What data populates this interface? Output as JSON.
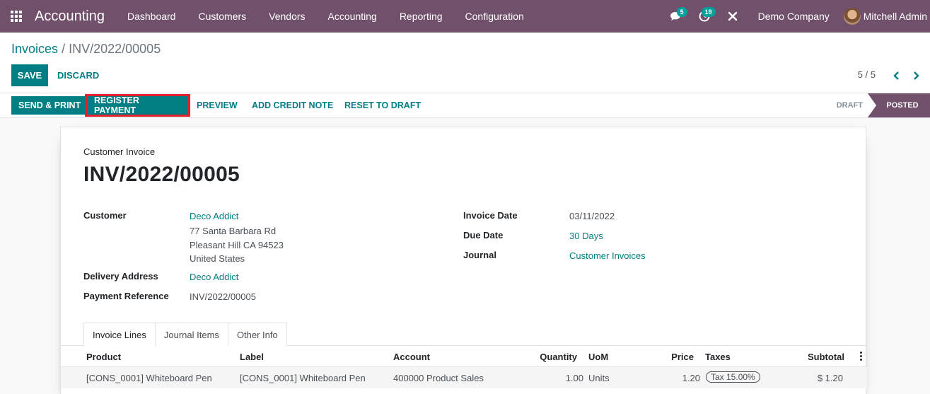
{
  "navbar": {
    "app_name": "Accounting",
    "menu": [
      "Dashboard",
      "Customers",
      "Vendors",
      "Accounting",
      "Reporting",
      "Configuration"
    ],
    "messages_count": "5",
    "activities_count": "19",
    "company": "Demo Company",
    "user": "Mitchell Admin"
  },
  "breadcrumb": {
    "parent": "Invoices",
    "separator": "/",
    "current": "INV/2022/00005"
  },
  "actions": {
    "save": "SAVE",
    "discard": "DISCARD"
  },
  "pager": {
    "value": "5 / 5"
  },
  "statusbar": {
    "buttons": {
      "send_print": "SEND & PRINT",
      "register_payment": "REGISTER PAYMENT",
      "preview": "PREVIEW",
      "add_credit_note": "ADD CREDIT NOTE",
      "reset_to_draft": "RESET TO DRAFT"
    },
    "states": {
      "draft": "DRAFT",
      "posted": "POSTED"
    },
    "active_state": "posted"
  },
  "invoice": {
    "type": "Customer Invoice",
    "name": "INV/2022/00005",
    "customer_label": "Customer",
    "customer_name": "Deco Addict",
    "address_line1": "77 Santa Barbara Rd",
    "address_line2": "Pleasant Hill CA 94523",
    "address_line3": "United States",
    "delivery_label": "Delivery Address",
    "delivery_value": "Deco Addict",
    "payment_ref_label": "Payment Reference",
    "payment_ref_value": "INV/2022/00005",
    "invoice_date_label": "Invoice Date",
    "invoice_date_value": "03/11/2022",
    "due_date_label": "Due Date",
    "due_date_value": "30 Days",
    "journal_label": "Journal",
    "journal_value": "Customer Invoices"
  },
  "tabs": [
    "Invoice Lines",
    "Journal Items",
    "Other Info"
  ],
  "lines": {
    "columns": {
      "product": "Product",
      "label": "Label",
      "account": "Account",
      "quantity": "Quantity",
      "uom": "UoM",
      "price": "Price",
      "taxes": "Taxes",
      "subtotal": "Subtotal"
    },
    "rows": [
      {
        "product": "[CONS_0001] Whiteboard Pen",
        "label": "[CONS_0001] Whiteboard Pen",
        "account": "400000 Product Sales",
        "quantity": "1.00",
        "uom": "Units",
        "price": "1.20",
        "taxes": "Tax 15.00%",
        "subtotal": "$ 1.20"
      }
    ]
  },
  "colors": {
    "brand": "#71506b",
    "accent": "#017e84",
    "highlight": "#e3202c"
  }
}
